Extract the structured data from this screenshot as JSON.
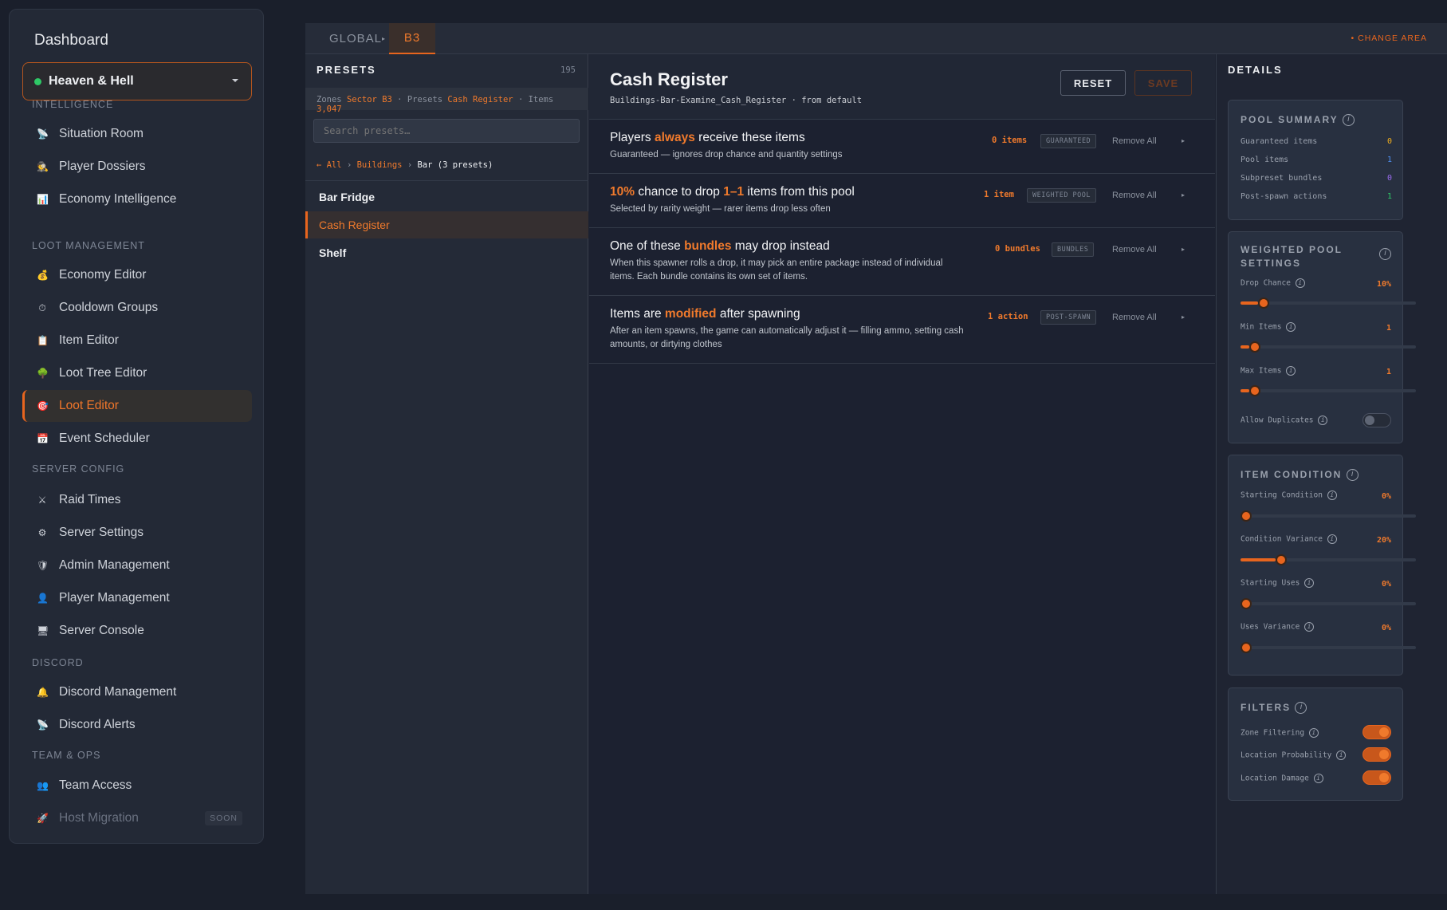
{
  "sidebar": {
    "title": "Dashboard",
    "server": {
      "name": "Heaven & Hell"
    },
    "sections": {
      "intelligence": "INTELLIGENCE",
      "loot": "LOOT MANAGEMENT",
      "server": "SERVER CONFIG",
      "discord": "DISCORD",
      "team": "TEAM & OPS"
    },
    "items": [
      {
        "label": "Situation Room",
        "icon": "satellite-dish-icon"
      },
      {
        "label": "Player Dossiers",
        "icon": "detective-icon"
      },
      {
        "label": "Economy Intelligence",
        "icon": "bar-chart-icon"
      },
      {
        "label": "Economy Editor",
        "icon": "money-bag-icon"
      },
      {
        "label": "Cooldown Groups",
        "icon": "stopwatch-icon"
      },
      {
        "label": "Item Editor",
        "icon": "clipboard-icon"
      },
      {
        "label": "Loot Tree Editor",
        "icon": "tree-icon"
      },
      {
        "label": "Loot Editor",
        "icon": "target-icon",
        "active": true
      },
      {
        "label": "Event Scheduler",
        "icon": "calendar-icon"
      },
      {
        "label": "Raid Times",
        "icon": "crossed-swords-icon"
      },
      {
        "label": "Server Settings",
        "icon": "gear-icon"
      },
      {
        "label": "Admin Management",
        "icon": "shield-icon"
      },
      {
        "label": "Player Management",
        "icon": "user-icon"
      },
      {
        "label": "Server Console",
        "icon": "monitor-icon"
      },
      {
        "label": "Discord Management",
        "icon": "bell-icon"
      },
      {
        "label": "Discord Alerts",
        "icon": "satellite-dish-icon"
      },
      {
        "label": "Team Access",
        "icon": "users-icon"
      },
      {
        "label": "Host Migration",
        "icon": "rocket-icon",
        "badge": "SOON",
        "disabled": true
      }
    ]
  },
  "topbar": {
    "tab_global": "GLOBAL",
    "tab_sep": "▸",
    "tab_area": "B3",
    "change_area": "• CHANGE AREA"
  },
  "presets": {
    "title": "PRESETS",
    "count": "195",
    "crumb": {
      "zones_label": "Zones",
      "zone": "Sector B3",
      "presets_label": "Presets",
      "preset": "Cash Register",
      "items_label": "Items",
      "items": "3,047",
      "sep": "·"
    },
    "search_placeholder": "Search presets…",
    "path": {
      "all": "← All",
      "sep": "›",
      "buildings": "Buildings",
      "current": "Bar (3 presets)"
    },
    "list": [
      "Bar Fridge",
      "Cash Register",
      "Shelf"
    ]
  },
  "editor": {
    "title": "Cash Register",
    "subtitle": "Buildings-Bar-Examine_Cash_Register · from default",
    "reset": "RESET",
    "save": "SAVE",
    "rules": [
      {
        "pre": "Players ",
        "hl": "always",
        "post": " receive these items",
        "desc": "Guaranteed — ignores drop chance and quantity settings",
        "count": "0 items",
        "badge": "GUARANTEED",
        "remove": "Remove All"
      },
      {
        "hl1": "10%",
        "mid1": " chance to drop ",
        "hl2": "1–1",
        "post": " items from this pool",
        "desc": "Selected by rarity weight — rarer items drop less often",
        "count": "1 item",
        "badge": "WEIGHTED POOL",
        "remove": "Remove All"
      },
      {
        "pre": "One of these ",
        "hl": "bundles",
        "post": " may drop instead",
        "desc": "When this spawner rolls a drop, it may pick an entire package instead of individual items. Each bundle contains its own set of items.",
        "count": "0 bundles",
        "badge": "BUNDLES",
        "remove": "Remove All"
      },
      {
        "pre": "Items are ",
        "hl": "modified",
        "post": " after spawning",
        "desc": "After an item spawns, the game can automatically adjust it — filling ammo, setting cash amounts, or dirtying clothes",
        "count": "1 action",
        "badge": "POST-SPAWN",
        "remove": "Remove All"
      }
    ]
  },
  "details": {
    "title": "DETAILS",
    "pool_summary": {
      "title": "POOL SUMMARY",
      "rows": [
        {
          "label": "Guaranteed items",
          "value": "0",
          "color": "#f2b01e"
        },
        {
          "label": "Pool items",
          "value": "1",
          "color": "#4f8ff0"
        },
        {
          "label": "Subpreset bundles",
          "value": "0",
          "color": "#9b6cf0"
        },
        {
          "label": "Post-spawn actions",
          "value": "1",
          "color": "#2ec866"
        }
      ]
    },
    "weighted": {
      "title": "WEIGHTED POOL SETTINGS",
      "drop_chance": {
        "label": "Drop Chance",
        "value": "10%",
        "level": 0.1
      },
      "min_items": {
        "label": "Min Items",
        "value": "1",
        "level": 0.05
      },
      "max_items": {
        "label": "Max Items",
        "value": "1",
        "level": 0.05
      },
      "allow_duplicates": {
        "label": "Allow Duplicates",
        "on": false
      }
    },
    "condition": {
      "title": "ITEM CONDITION",
      "starting_condition": {
        "label": "Starting Condition",
        "value": "0%",
        "level": 0
      },
      "condition_variance": {
        "label": "Condition Variance",
        "value": "20%",
        "level": 0.2
      },
      "starting_uses": {
        "label": "Starting Uses",
        "value": "0%",
        "level": 0
      },
      "uses_variance": {
        "label": "Uses Variance",
        "value": "0%",
        "level": 0
      }
    },
    "filters": {
      "title": "FILTERS",
      "zone_filtering": {
        "label": "Zone Filtering",
        "on": true
      },
      "location_probability": {
        "label": "Location Probability",
        "on": true
      },
      "location_damage": {
        "label": "Location Damage",
        "on": true
      }
    }
  }
}
